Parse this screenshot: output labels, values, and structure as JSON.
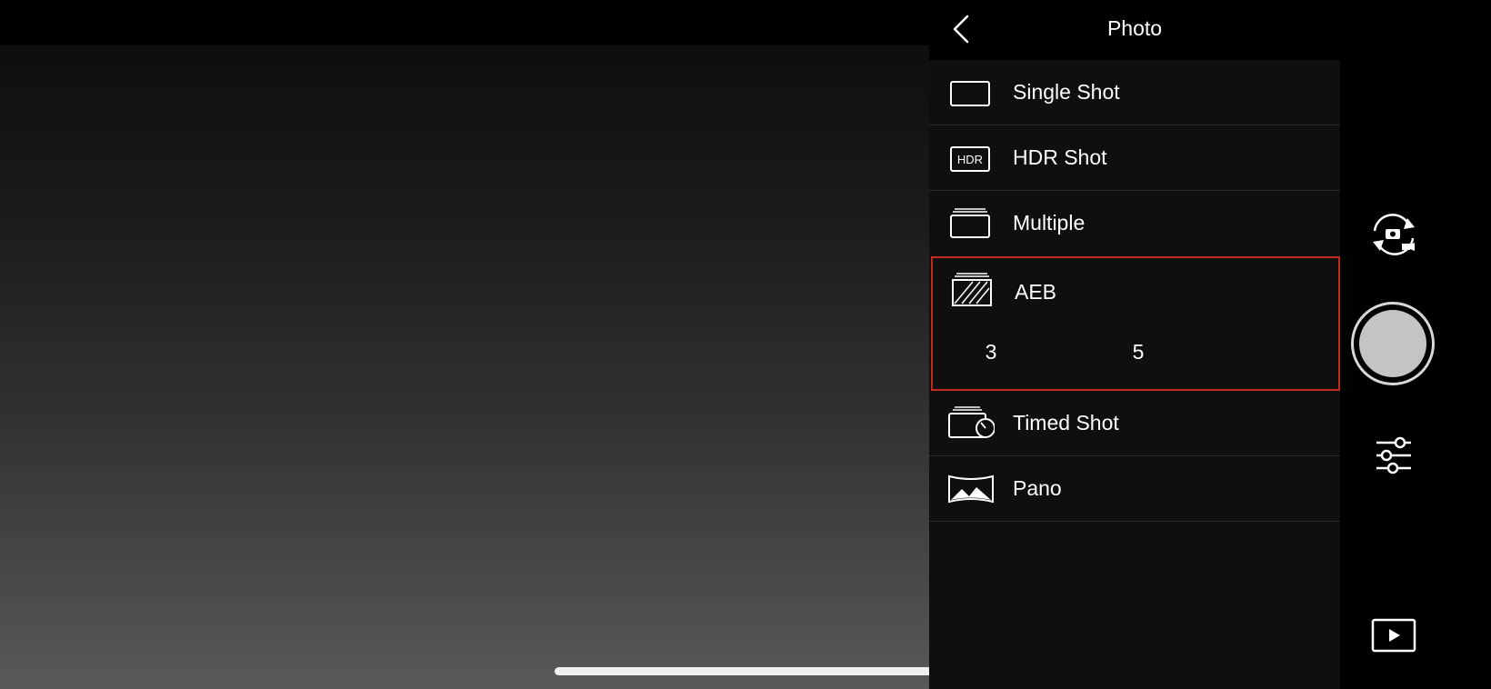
{
  "menu": {
    "title": "Photo",
    "items": [
      {
        "label": "Single Shot",
        "icon": "single-shot-icon"
      },
      {
        "label": "HDR Shot",
        "icon": "hdr-icon",
        "icon_text": "HDR"
      },
      {
        "label": "Multiple",
        "icon": "multiple-shot-icon"
      },
      {
        "label": "AEB",
        "icon": "aeb-icon",
        "selected": true,
        "options": [
          "3",
          "5"
        ]
      },
      {
        "label": "Timed Shot",
        "icon": "timed-shot-icon"
      },
      {
        "label": "Pano",
        "icon": "pano-icon"
      }
    ]
  },
  "controls": {
    "switch_mode_icon": "camera-video-switch-icon",
    "shutter_icon": "shutter-button",
    "settings_icon": "sliders-icon",
    "playback_icon": "play-icon"
  },
  "colors": {
    "selection_border": "#c0291c",
    "panel_background": "#0f0f0f",
    "text": "#ffffff"
  }
}
